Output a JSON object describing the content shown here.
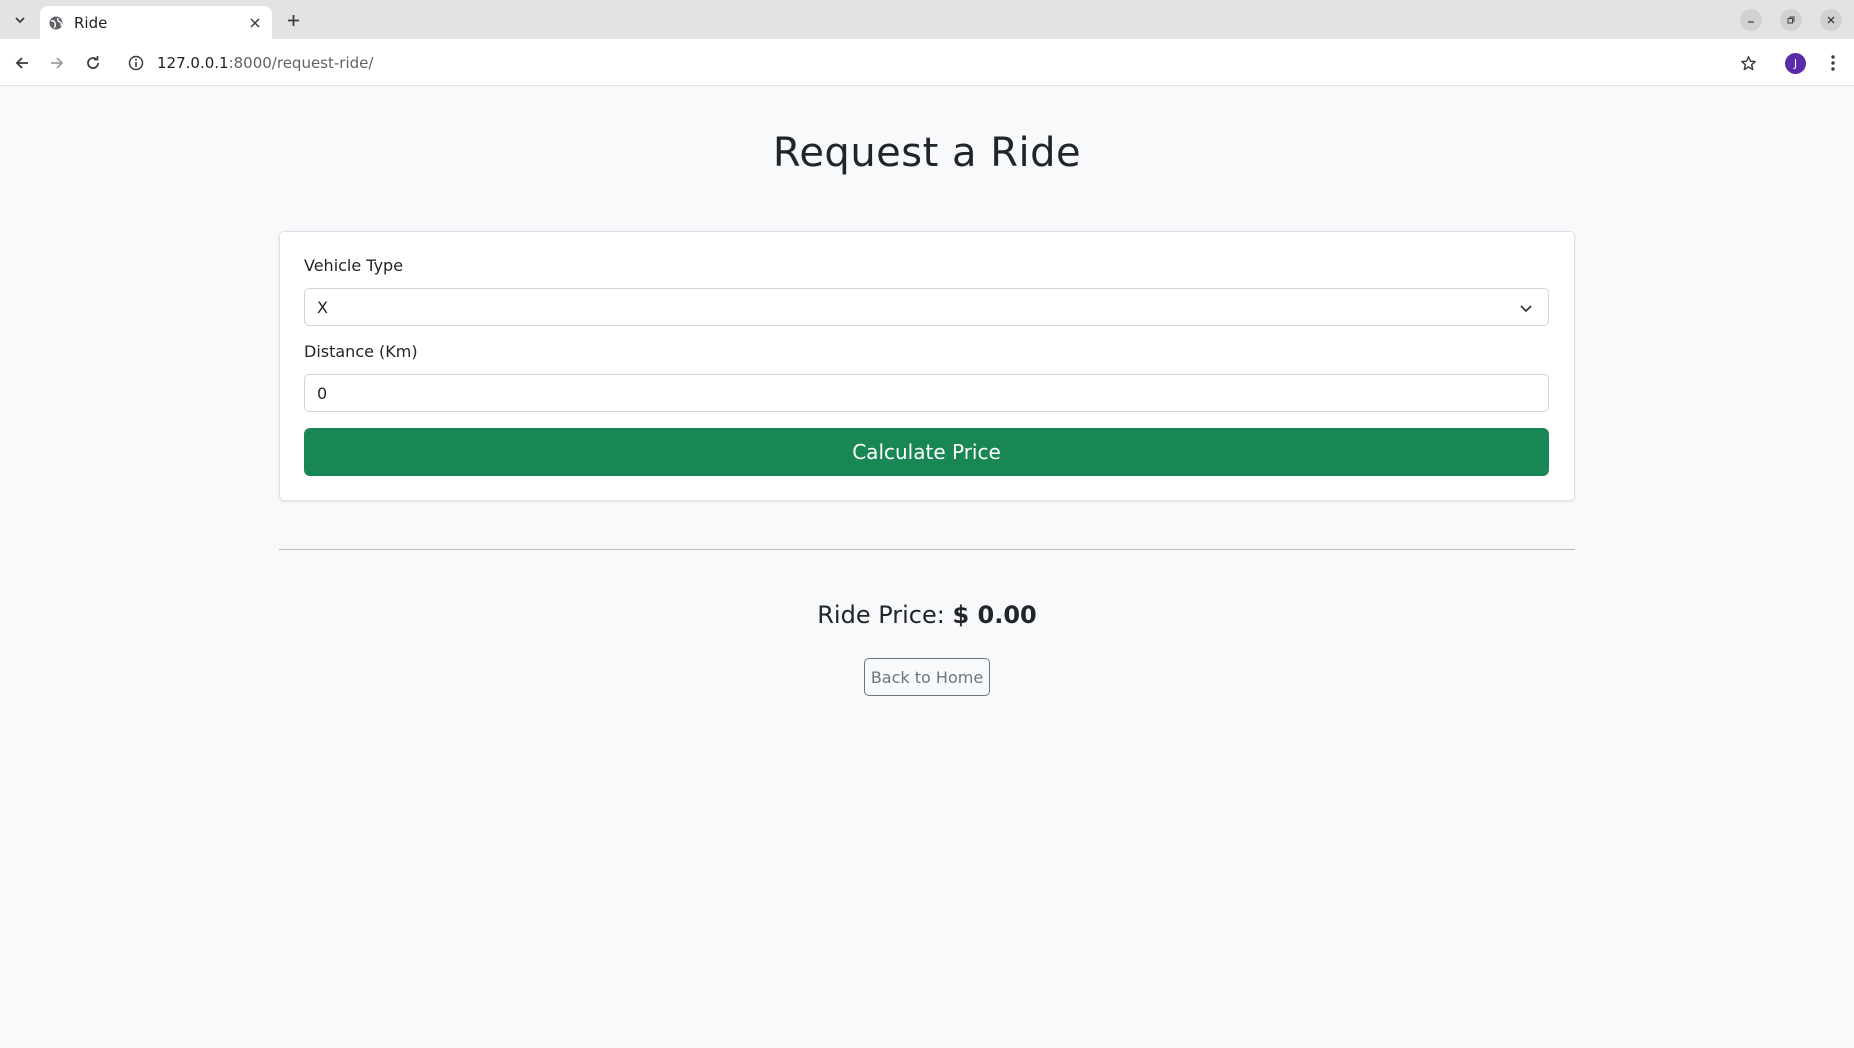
{
  "browser": {
    "tab_title": "Ride",
    "url_host": "127.0.0.1",
    "url_rest": ":8000/request-ride/",
    "avatar_letter": "J"
  },
  "page": {
    "title": "Request a Ride",
    "vehicle_label": "Vehicle Type",
    "vehicle_value": "X",
    "distance_label": "Distance (Km)",
    "distance_value": "0",
    "calculate_label": "Calculate Price",
    "price_label": "Ride Price:",
    "price_value": "$ 0.00",
    "home_label": "Back to Home"
  },
  "colors": {
    "primary_green": "#198754",
    "background": "#f8f9fa",
    "avatar": "#5b2ca8"
  }
}
